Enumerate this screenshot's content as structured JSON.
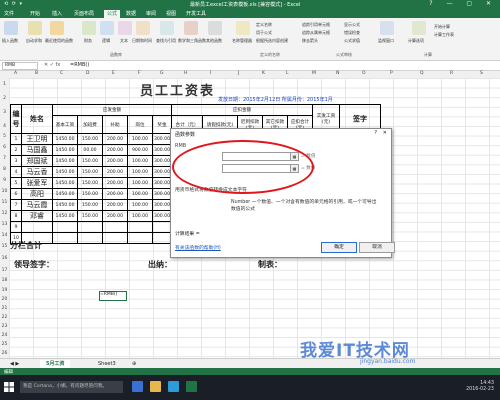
{
  "window": {
    "title": "最新员工excel工资表模板.xls [兼容模式] - Excel",
    "quick_access": "⟲ ⟳ ▾",
    "controls": "? — ▢ ✕"
  },
  "tabs": [
    "文件",
    "开始",
    "插入",
    "页面布局",
    "公式",
    "数据",
    "审阅",
    "视图",
    "开发工具"
  ],
  "active_tab": "公式",
  "ribbon": {
    "buttons": [
      "插入函数",
      "自动求和",
      "最近使用的函数",
      "财务",
      "逻辑",
      "文本",
      "日期和时间",
      "查找与引用",
      "数学和三角函数",
      "其他函数",
      "名称管理器",
      "计算选项"
    ],
    "small_items": [
      "定义名称",
      "用于公式",
      "根据所选内容创建",
      "追踪引用单元格",
      "追踪从属单元格",
      "移去箭头",
      "显示公式",
      "错误检查",
      "公式求值",
      "监视窗口",
      "开始计算",
      "计算工作表"
    ],
    "groups": [
      "函数库",
      "定义的名称",
      "公式审核",
      "计算"
    ]
  },
  "formula_bar": {
    "name_box": "RMB",
    "fx": "✕ ✓ fx",
    "formula": "=RMB()"
  },
  "columns": [
    "A",
    "B",
    "C",
    "D",
    "E",
    "F",
    "G",
    "H",
    "I",
    "J",
    "K",
    "L",
    "M",
    "N",
    "O",
    "P",
    "Q",
    "R",
    "S"
  ],
  "rows": [
    "1",
    "2",
    "3",
    "4",
    "5",
    "6",
    "7",
    "8",
    "9",
    "10",
    "11",
    "12",
    "13",
    "14",
    "15",
    "16",
    "17",
    "18",
    "19",
    "20",
    "21",
    "22",
    "23",
    "24",
    "25",
    "26",
    "27",
    "28",
    "29"
  ],
  "sheet": {
    "title": "员工工资表",
    "date_line": "发放日期：2015年2月12日  所属月份：2015年1月",
    "header_top": {
      "no": "编号",
      "name": "姓名",
      "should": "应发金额",
      "deduct": "应扣金额",
      "actual": "实发工资(元)",
      "sign": "签字"
    },
    "header_sub": [
      "基本工资",
      "加班费",
      "补助",
      "岗位",
      "奖金",
      "合计（元）",
      "请假扣款(元)",
      "迟到扣款(元)",
      "其它扣款(元)",
      "应扣合计(元)"
    ],
    "employees": [
      {
        "no": "1",
        "name": "王卫明",
        "vals": [
          "1450.00",
          "150.00",
          "200.00",
          "100.00",
          "300.00"
        ]
      },
      {
        "no": "2",
        "name": "马国鑫",
        "vals": [
          "1450.00",
          "00.00",
          "200.00",
          "900.00",
          "300.00"
        ]
      },
      {
        "no": "3",
        "name": "郑国斌",
        "vals": [
          "1450.00",
          "150.00",
          "200.00",
          "100.00",
          "300.00"
        ]
      },
      {
        "no": "4",
        "name": "马云香",
        "vals": [
          "1450.00",
          "150.00",
          "200.00",
          "100.00",
          "300.00"
        ]
      },
      {
        "no": "5",
        "name": "张爱军",
        "vals": [
          "1450.00",
          "150.00",
          "200.00",
          "100.00",
          "300.00"
        ]
      },
      {
        "no": "6",
        "name": "高阳",
        "vals": [
          "1450.00",
          "150.00",
          "200.00",
          "100.00",
          "300.00"
        ]
      },
      {
        "no": "7",
        "name": "马云霞",
        "vals": [
          "1450.00",
          "150.00",
          "200.00",
          "100.00",
          "300.00"
        ]
      },
      {
        "no": "8",
        "name": "邓睿",
        "vals": [
          "1450.00",
          "150.00",
          "200.00",
          "100.00",
          "300.00"
        ]
      },
      {
        "no": "9",
        "name": "",
        "vals": [
          "",
          "",
          "",
          "",
          ""
        ]
      },
      {
        "no": "10",
        "name": "",
        "vals": [
          "",
          "",
          "",
          "",
          ""
        ]
      }
    ],
    "sum_label": "分栏合计",
    "sign_label": "领导签字：",
    "cashier_label": "出纳：",
    "maker_label": "制表：",
    "active_cell": "=RMB()"
  },
  "dialog": {
    "title": "函数参数",
    "help": "?",
    "close": "✕",
    "function_name": "RMB",
    "args": [
      {
        "label": "Number",
        "value": "",
        "result": "= 数值"
      },
      {
        "label": "Decimals",
        "value": "",
        "result": "= 数值"
      }
    ],
    "description": "用货币格式将数值转换成文本字符",
    "arg_description": "Number  一个数值、一个对含有数值的单元格的引用，或一个可导出数值的公式",
    "calc_result": "计算结果 =",
    "help_link": "有关该函数的帮助(H)",
    "ok": "确定",
    "cancel": "取消"
  },
  "sheet_tabs": [
    "5月工资",
    "Sheet3"
  ],
  "active_sheet": "5月工资",
  "status": "编辑",
  "taskbar": {
    "search": "我是 Cortana，小娜。有问题尽管问我。",
    "time": "14:43",
    "date": "2016-02-23"
  },
  "watermark": {
    "main": "我爱IT技术网",
    "sub": "jingyan.baidu.com"
  },
  "colors": {
    "excel_green": "#217346",
    "highlight_red": "#e0181e",
    "link_blue": "#1a56c4"
  }
}
